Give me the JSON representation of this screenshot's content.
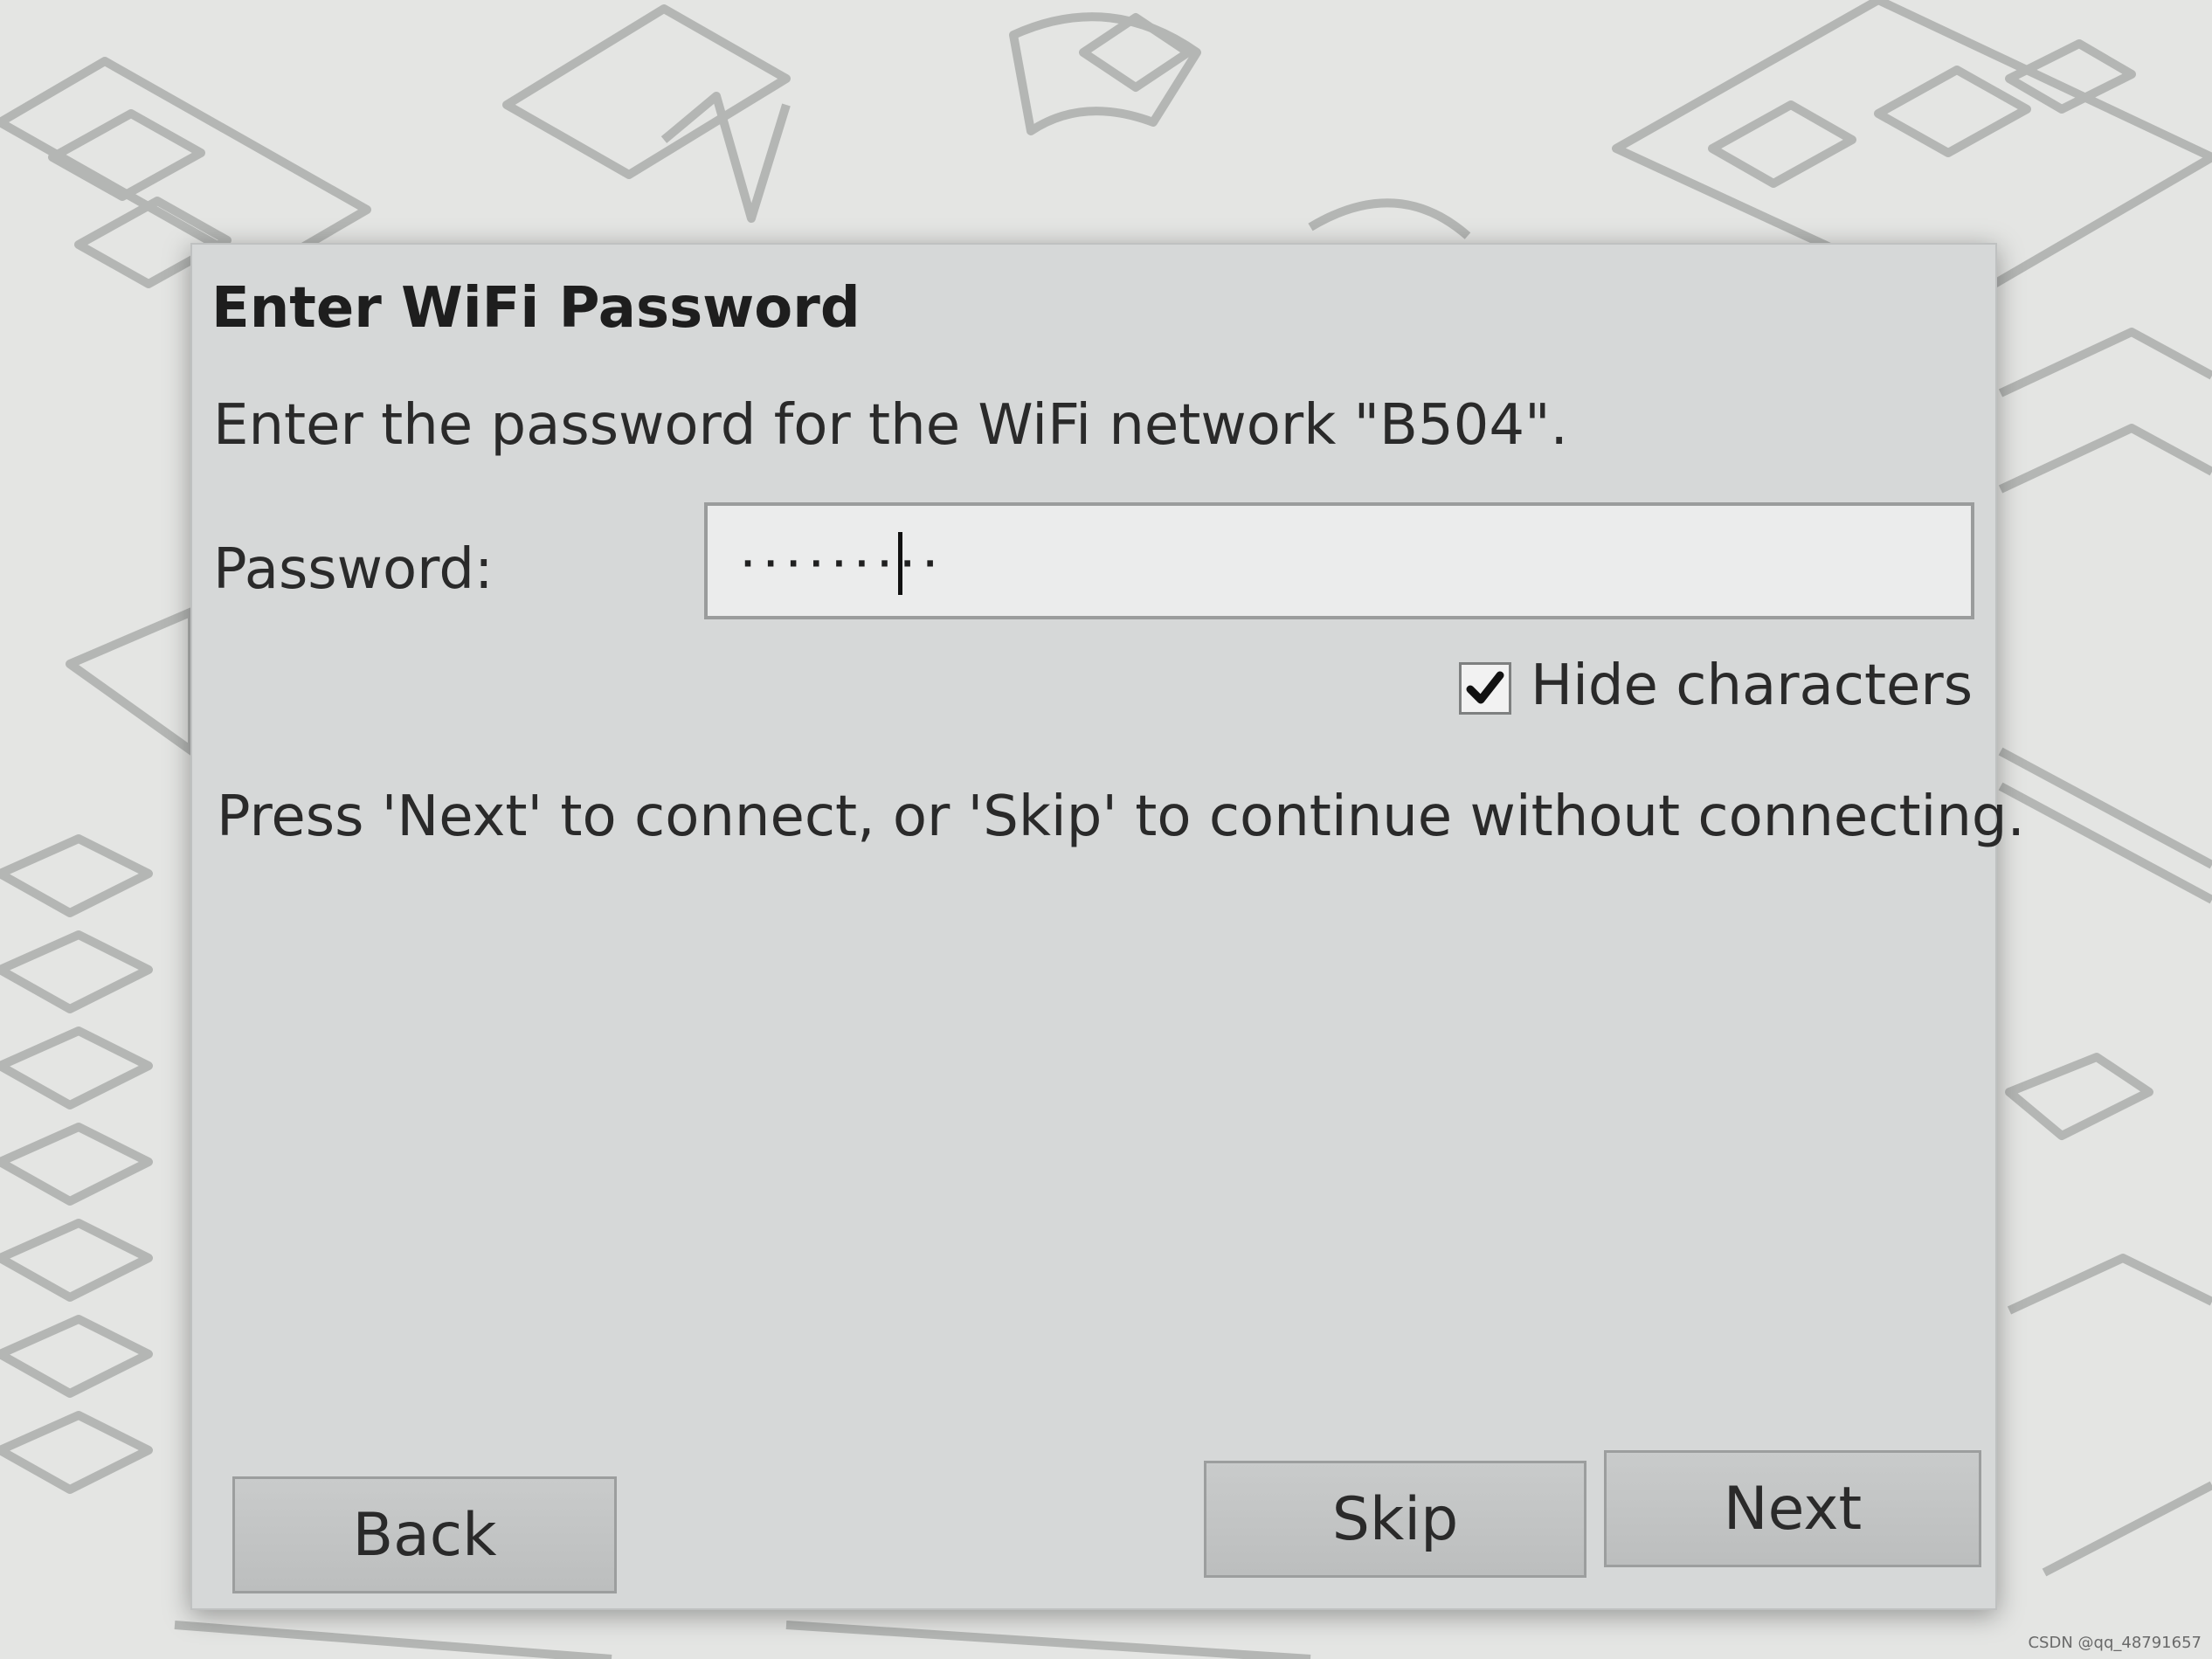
{
  "dialog": {
    "title": "Enter WiFi Password",
    "description": "Enter the password for the WiFi network \"B504\".",
    "password_label": "Password:",
    "password_value_masked": "·········",
    "hide_characters_label": "Hide characters",
    "hide_characters_checked": true,
    "hint": "Press 'Next' to connect, or 'Skip' to continue without connecting.",
    "buttons": {
      "back": "Back",
      "skip": "Skip",
      "next": "Next"
    }
  },
  "watermark": "CSDN @qq_48791657",
  "colors": {
    "dialog_bg": "#d6d8d8",
    "input_bg": "#ebecec",
    "button_bg": "#c3c5c5",
    "text": "#2a2a2a"
  }
}
